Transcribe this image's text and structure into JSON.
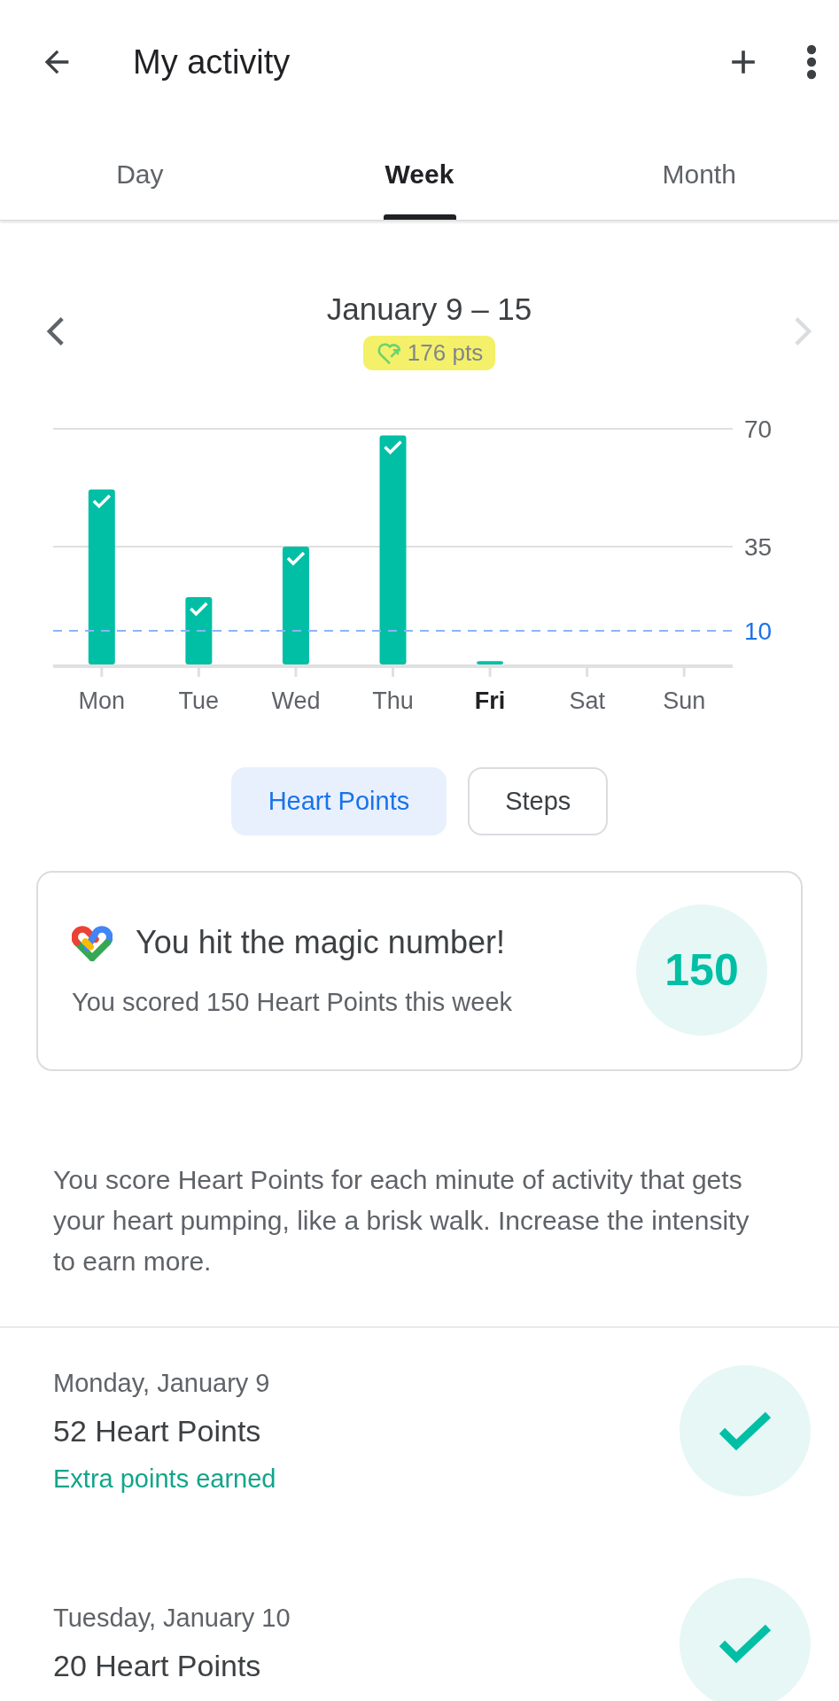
{
  "app_bar": {
    "title": "My activity"
  },
  "tabs": [
    {
      "label": "Day",
      "selected": false
    },
    {
      "label": "Week",
      "selected": true
    },
    {
      "label": "Month",
      "selected": false
    }
  ],
  "period": {
    "title": "January 9 – 15",
    "points": "176 pts",
    "next_disabled": true
  },
  "chart_data": {
    "type": "bar",
    "categories": [
      "Mon",
      "Tue",
      "Wed",
      "Thu",
      "Fri",
      "Sat",
      "Sun"
    ],
    "values": [
      52,
      20,
      35,
      68,
      1,
      null,
      null
    ],
    "ylim": [
      0,
      70
    ],
    "yticks": [
      35,
      70
    ]
  },
  "daily_goal": {
    "label": "10"
  },
  "day_states": [
    {
      "selected": false
    },
    {
      "selected": false
    },
    {
      "selected": false
    },
    {
      "selected": false
    },
    {
      "selected": true
    },
    {
      "selected": false
    },
    {
      "selected": false
    }
  ],
  "metric_toggle": [
    {
      "label": "Heart Points",
      "selected": true
    },
    {
      "label": "Steps",
      "selected": false
    }
  ],
  "goal_card": {
    "title": "You hit the magic number!",
    "subtitle": "You scored 150 Heart Points this week",
    "value": "150"
  },
  "info": "You score Heart Points for each minute of activity that gets your heart pumping, like a brisk walk. Increase the intensity to earn more.",
  "days": [
    {
      "date": "Monday, January 9",
      "points": "52 Heart Points",
      "note": "Extra points earned",
      "goal_met": true
    },
    {
      "date": "Tuesday, January 10",
      "points": "20 Heart Points",
      "goal_met": true
    }
  ]
}
